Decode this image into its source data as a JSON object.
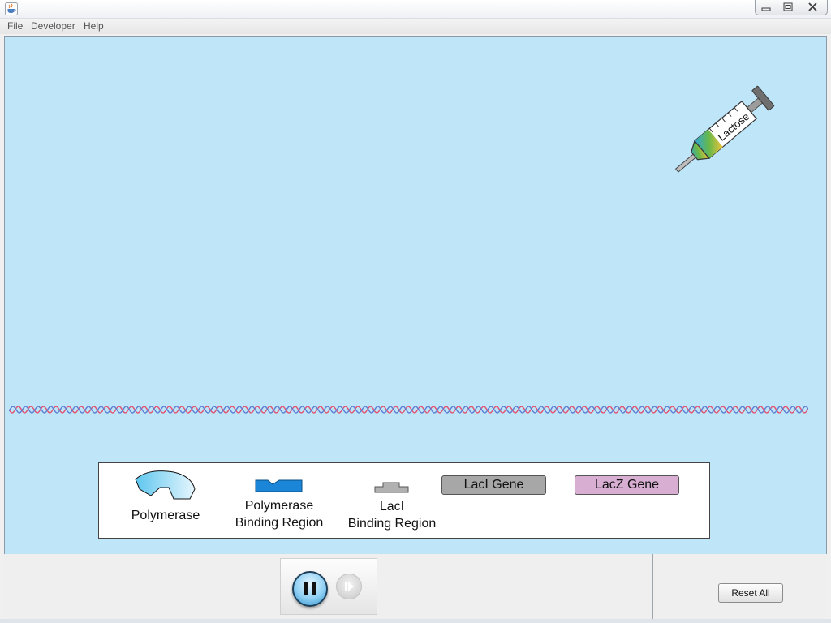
{
  "menubar": {
    "items": [
      {
        "label": "File"
      },
      {
        "label": "Developer"
      },
      {
        "label": "Help"
      }
    ]
  },
  "syringe": {
    "label": "Lactose"
  },
  "legend": {
    "polymerase": "Polymerase",
    "polymerase_binding_region_line1": "Polymerase",
    "polymerase_binding_region_line2": "Binding Region",
    "laci_binding_region_line1": "LacI",
    "laci_binding_region_line2": "Binding Region",
    "laci_gene": "LacI Gene",
    "lacz_gene": "LacZ Gene"
  },
  "controls": {
    "reset_label": "Reset All"
  },
  "colors": {
    "canvas_background": "#bfe5f8",
    "laci_gene": "#a7a7a7",
    "lacz_gene": "#d8aed3",
    "binding_region": "#1b86d8",
    "dna_strand_a": "#e2526f",
    "dna_strand_b": "#5d7fd4"
  },
  "icons": {
    "app": "java-coffee-cup-icon",
    "minimize": "minimize-icon",
    "maximize": "maximize-icon",
    "close": "close-icon",
    "pause": "pause-icon",
    "step": "step-forward-icon"
  }
}
